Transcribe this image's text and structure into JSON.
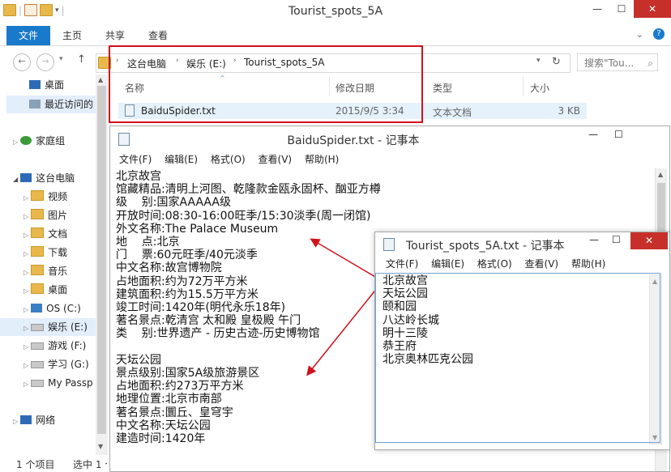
{
  "explorer": {
    "title": "Tourist_spots_5A",
    "ribbon_tabs": [
      "文件",
      "主页",
      "共享",
      "查看"
    ],
    "breadcrumb": [
      "这台电脑",
      "娱乐 (E:)",
      "Tourist_spots_5A"
    ],
    "search_placeholder": "搜索\"Tou...",
    "columns": [
      "名称",
      "修改日期",
      "类型",
      "大小"
    ],
    "file": {
      "name": "BaiduSpider.txt",
      "date": "2015/9/5 3:34",
      "type": "文本文档",
      "size": "3 KB"
    },
    "nav_items": [
      "桌面",
      "最近访问的",
      "家庭组",
      "这台电脑",
      "视频",
      "图片",
      "文档",
      "下载",
      "音乐",
      "桌面",
      "OS (C:)",
      "娱乐 (E:)",
      "游戏 (F:)",
      "学习 (G:)",
      "My Passp",
      "网络"
    ],
    "status_left": "1 个项目",
    "status_right": "选中 1 个"
  },
  "notepad_main": {
    "title": "BaiduSpider.txt - 记事本",
    "menu": [
      "文件(F)",
      "编辑(E)",
      "格式(O)",
      "查看(V)",
      "帮助(H)"
    ],
    "lines": [
      "北京故宫",
      "馆藏精品:清明上河图、乾隆款金瓯永固杯、酗亚方樽",
      "级    别:国家AAAAA级",
      "开放时间:08:30-16:00旺季/15:30淡季(周一闭馆)",
      "外文名称:The Palace Museum",
      "地    点:北京",
      "门    票:60元旺季/40元淡季",
      "中文名称:故宫博物院",
      "占地面积:约为72万平方米",
      "建筑面积:约为15.5万平方米",
      "竣工时间:1420年(明代永乐18年)",
      "著名景点:乾清宫 太和殿 皇极殿 午门",
      "类    别:世界遗产 - 历史古迹-历史博物馆",
      "",
      "天坛公园",
      "景点级别:国家5A级旅游景区",
      "占地面积:约273万平方米",
      "地理位置:北京市南部",
      "著名景点:圜丘、皇穹宇",
      "中文名称:天坛公园",
      "建造时间:1420年"
    ]
  },
  "notepad_small": {
    "title": "Tourist_spots_5A.txt - 记事本",
    "menu": [
      "文件(F)",
      "编辑(E)",
      "格式(O)",
      "查看(V)",
      "帮助(H)"
    ],
    "lines": [
      "北京故宫",
      "天坛公园",
      "颐和园",
      "八达岭长城",
      "明十三陵",
      "恭王府",
      "北京奥林匹克公园"
    ]
  },
  "colors": {
    "accent": "#1979ca",
    "annotation_red": "#d0121b",
    "close_red": "#c7302a"
  }
}
